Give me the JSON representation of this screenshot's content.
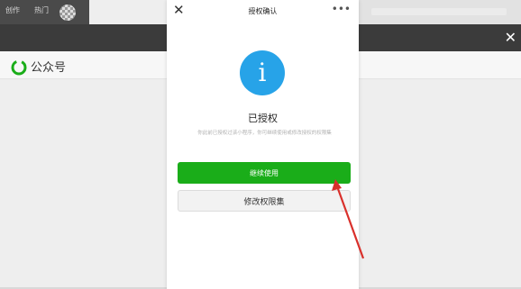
{
  "topbar": {
    "tab_a": "创作",
    "tab_b": "热门"
  },
  "brand": {
    "name": "公众号"
  },
  "modal": {
    "title": "授权确认",
    "status": "已授权",
    "description": "你此前已授权过该小程序，你可继续使用或修改授权的权限集",
    "continue_label": "继续使用",
    "modify_label": "修改权限集"
  },
  "icons": {
    "close": "close-icon",
    "more": "more-icon",
    "info": "info-icon",
    "logo": "wechat-official-account-logo"
  },
  "colors": {
    "primary_button": "#1aad19",
    "info_icon": "#27a3e8",
    "annotation_arrow": "#d9302b",
    "dark_band": "#3b3b3b"
  }
}
